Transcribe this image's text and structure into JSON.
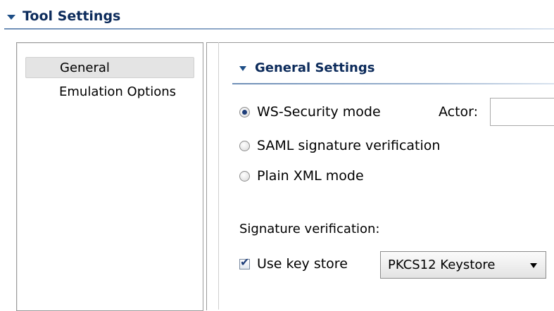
{
  "tool_settings": {
    "title": "Tool Settings"
  },
  "nav": {
    "items": [
      {
        "label": "General",
        "selected": true
      },
      {
        "label": "Emulation Options",
        "selected": false
      }
    ]
  },
  "general_settings": {
    "title": "General Settings",
    "modes": [
      {
        "label": "WS-Security mode",
        "checked": true
      },
      {
        "label": "SAML signature verification",
        "checked": false
      },
      {
        "label": "Plain XML mode",
        "checked": false
      }
    ],
    "actor": {
      "label": "Actor:",
      "value": ""
    },
    "signature_verification_label": "Signature verification:",
    "use_key_store": {
      "label": "Use key store",
      "checked": true
    },
    "keystore_select": {
      "value": "PKCS12 Keystore"
    }
  },
  "colors": {
    "header_text": "#0c2b5b",
    "accent": "#1d4e86"
  }
}
